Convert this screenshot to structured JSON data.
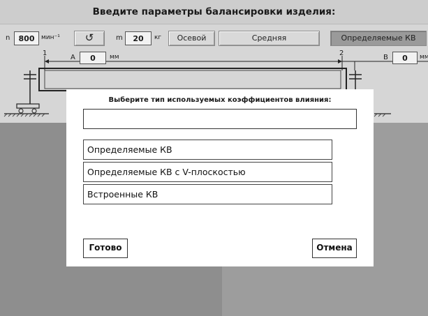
{
  "title": "Введите параметры балансировки изделия:",
  "params": {
    "n_label": "n",
    "n_value": "800",
    "n_unit": "мин⁻¹",
    "rotation_glyph": "↺",
    "m_label": "m",
    "m_value": "20",
    "m_unit": "кг",
    "axial_btn": "Осевой",
    "middle_btn": "Средняя",
    "coef_btn": "Определяемые КВ"
  },
  "diagram": {
    "support1": "1",
    "support2": "2",
    "a_label": "A",
    "a_value": "0",
    "a_unit": "мм",
    "b_label": "B",
    "b_value": "0",
    "b_unit": "мм"
  },
  "dialog": {
    "prompt": "Выберите тип используемых коэффициентов влияния:",
    "field_value": "",
    "options": [
      "Определяемые КВ",
      "Определяемые КВ с V-плоскостью",
      "Встроенные КВ"
    ],
    "ok": "Готово",
    "cancel": "Отмена"
  },
  "colors": {
    "top_bg": "#d6d6d6",
    "lower_left": "#8e8e8e",
    "lower_right": "#9d9d9d",
    "dialog_bg": "#ffffff"
  }
}
